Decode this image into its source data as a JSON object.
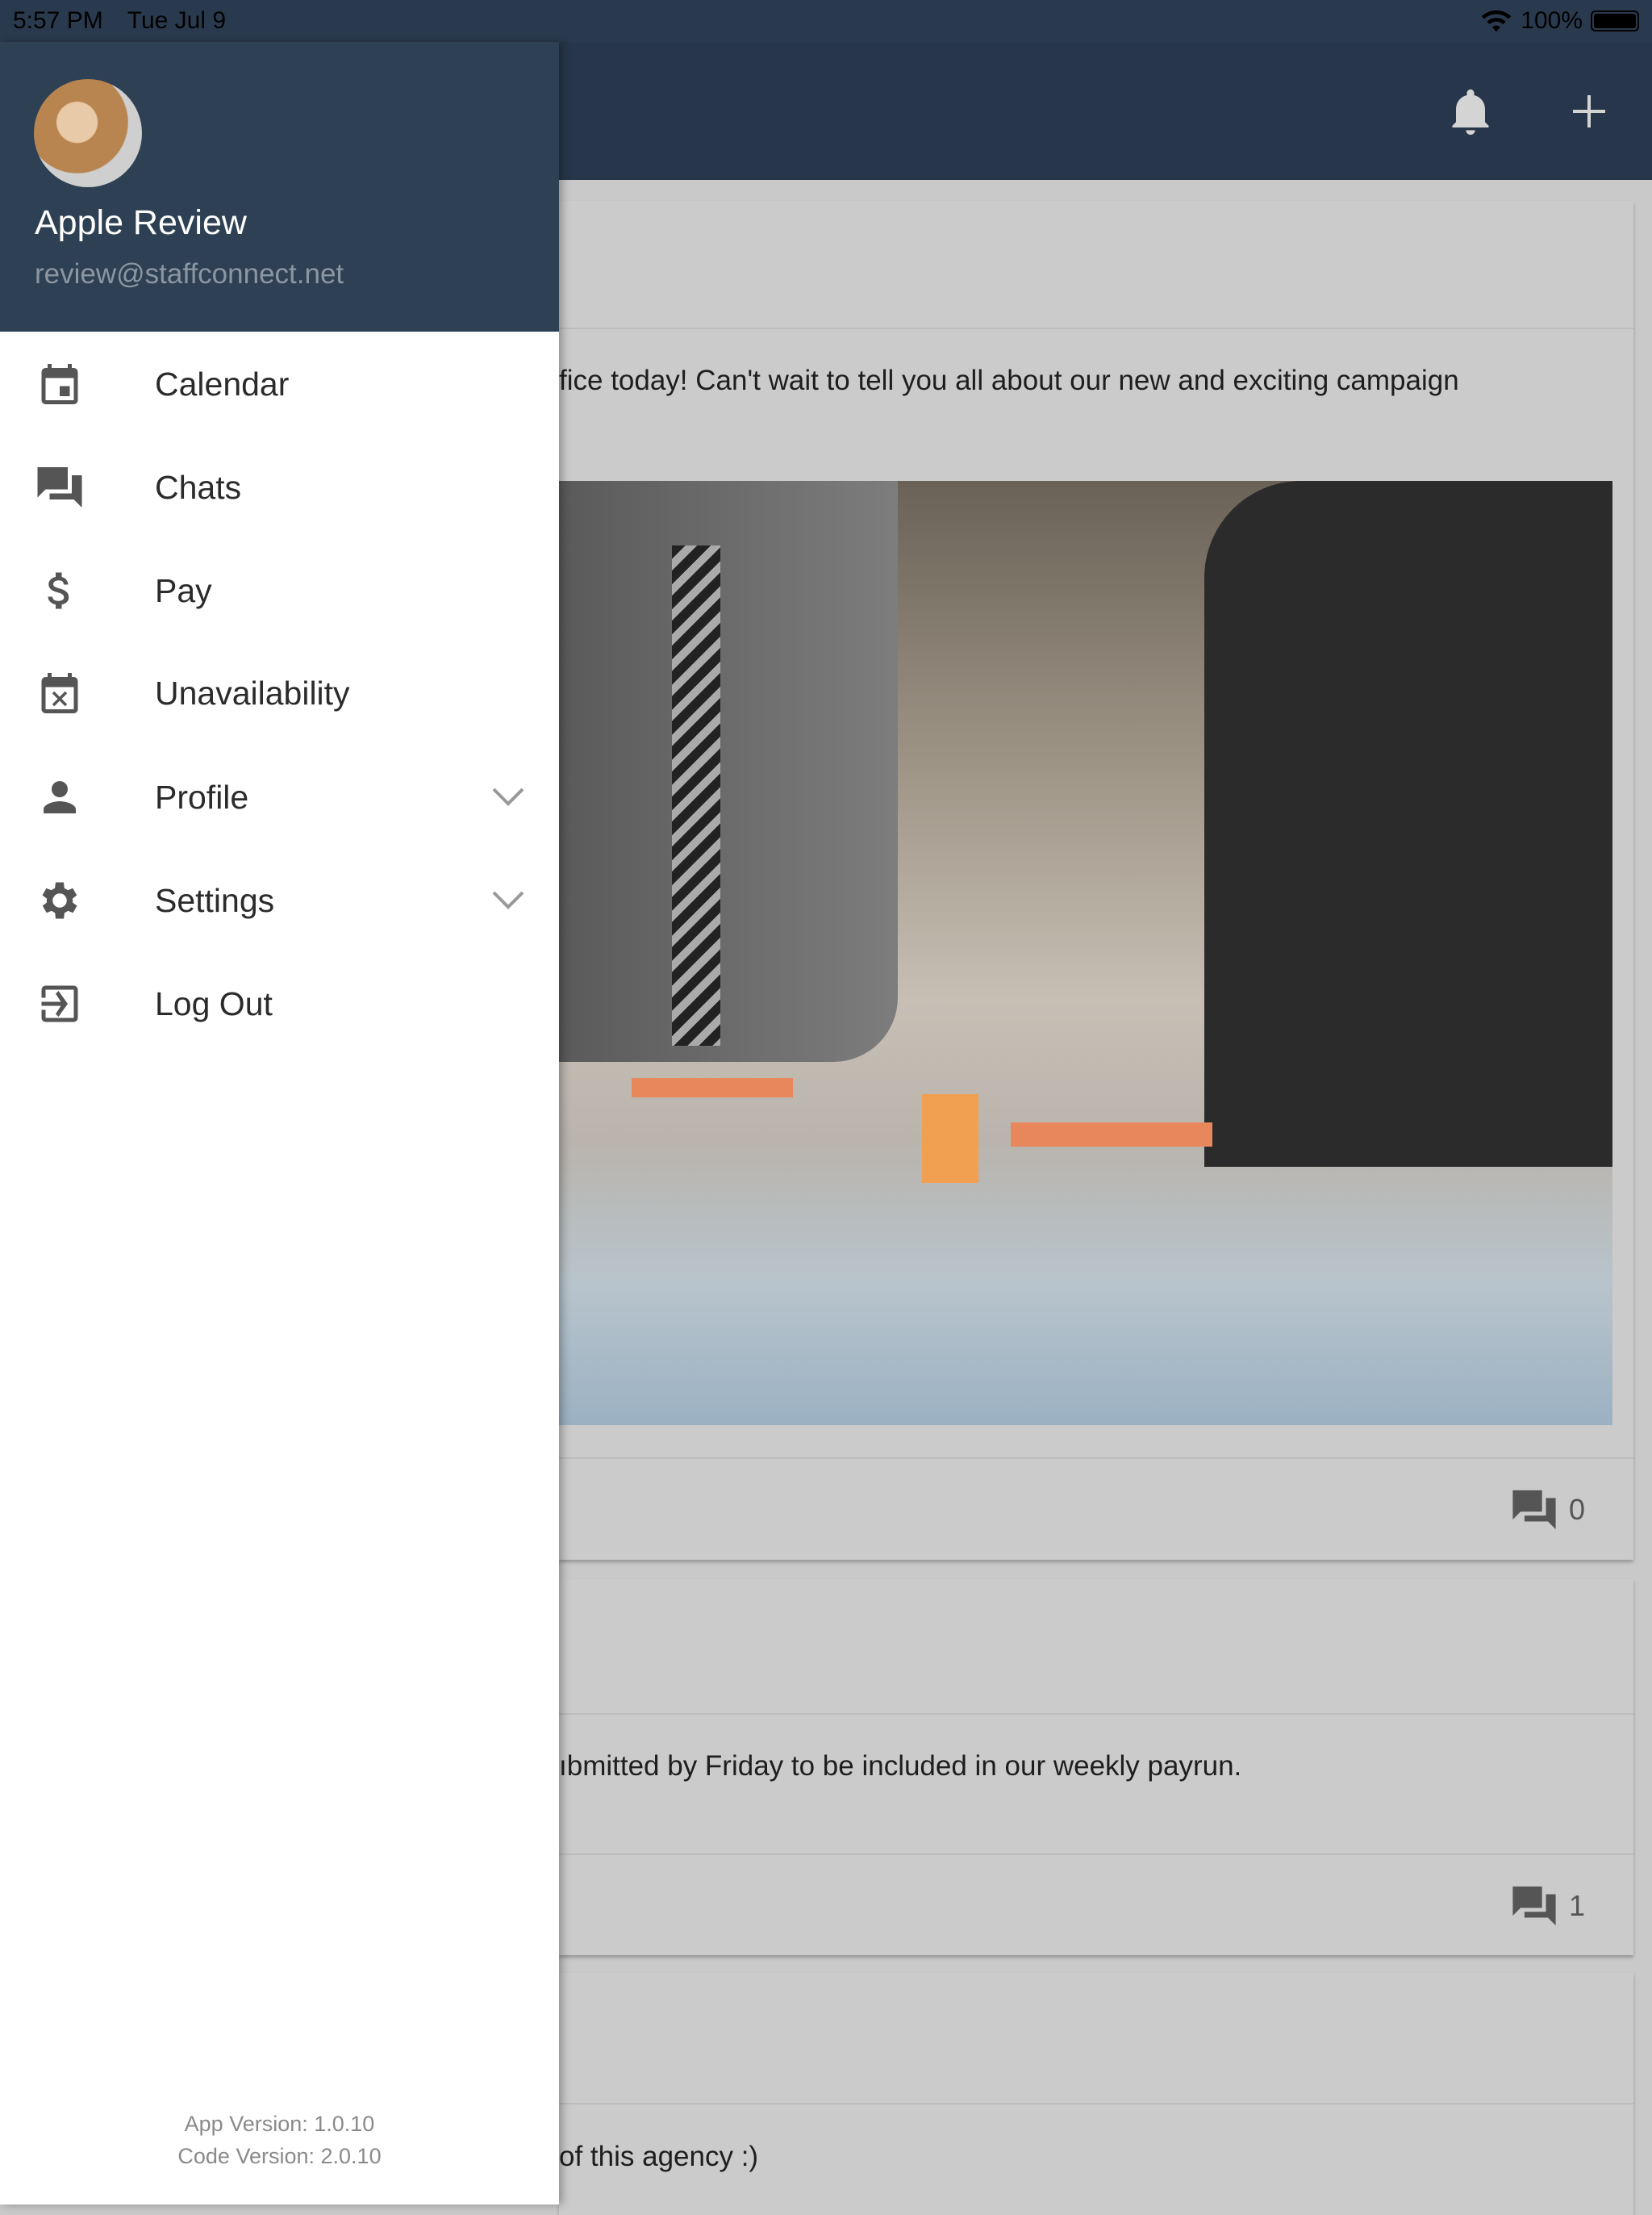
{
  "status_bar": {
    "time": "5:57 PM",
    "date": "Tue Jul 9",
    "battery": "100%"
  },
  "app_bar": {
    "icons": [
      "bell-icon",
      "plus-icon"
    ]
  },
  "feed": [
    {
      "text": "fice today! Can't wait to tell you all about our new and exciting campaign",
      "comment_count": "0",
      "has_image": true
    },
    {
      "text": "ıbmitted by Friday to be included in our weekly payrun.",
      "comment_count": "1"
    },
    {
      "text": "of this agency :)"
    }
  ],
  "drawer": {
    "user": {
      "name": "Apple Review",
      "email": "review@staffconnect.net"
    },
    "items": [
      {
        "label": "Calendar",
        "icon": "calendar-icon"
      },
      {
        "label": "Chats",
        "icon": "chats-icon"
      },
      {
        "label": "Pay",
        "icon": "dollar-icon"
      },
      {
        "label": "Unavailability",
        "icon": "calendar-x-icon"
      },
      {
        "label": "Profile",
        "icon": "person-icon",
        "expandable": true
      },
      {
        "label": "Settings",
        "icon": "gear-icon",
        "expandable": true
      },
      {
        "label": "Log Out",
        "icon": "logout-icon"
      }
    ],
    "app_version": "App Version: 1.0.10",
    "code_version": "Code Version: 2.0.10"
  },
  "colors": {
    "drawer_header": "#2e4053",
    "app_bar": "#27364a",
    "overlay_bg": "#cbcbcb"
  }
}
